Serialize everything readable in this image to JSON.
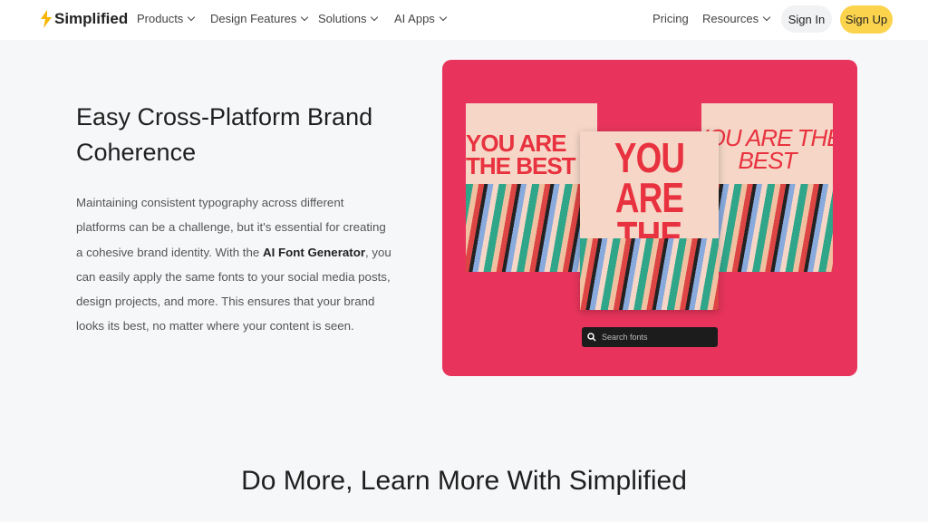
{
  "nav": {
    "brand": "Simplified",
    "items": [
      "Products",
      "Design Features",
      "Solutions",
      "AI Apps"
    ],
    "pricing": "Pricing",
    "resources": "Resources",
    "sign_in": "Sign In",
    "sign_up": "Sign Up"
  },
  "section": {
    "title": "Easy Cross-Platform Brand Coherence",
    "body_before": "Maintaining consistent typography across different platforms can be a challenge, but it's essential for creating a cohesive brand identity. With the ",
    "body_bold": "AI Font Generator",
    "body_after": ", you can easily apply the same fonts to your social media posts, design projects, and more. This ensures that your brand looks its best, no matter where your content is seen."
  },
  "preview": {
    "poster_left": "YOU ARE THE BEST",
    "poster_center": "YOU ARE THE BEST",
    "poster_right": "YOU ARE THE BEST",
    "search_placeholder": "Search fonts",
    "accent": "#e8345c"
  },
  "next_heading": "Do More, Learn More With Simplified"
}
